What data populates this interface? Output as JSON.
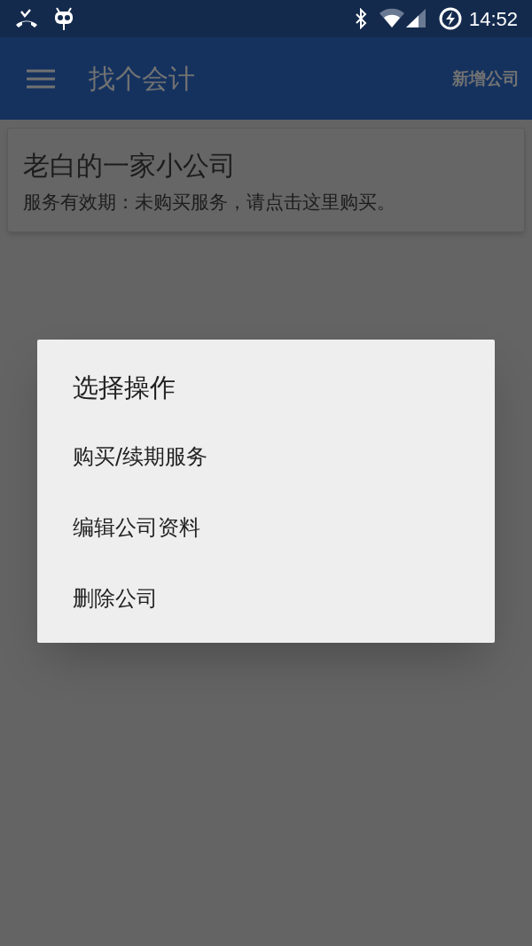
{
  "status_bar": {
    "time": "14:52"
  },
  "app_bar": {
    "title": "找个会计",
    "action": "新增公司"
  },
  "companies": [
    {
      "name": "老白的一家小公司",
      "service": "服务有效期：未购买服务，请点击这里购买。"
    }
  ],
  "dialog": {
    "title": "选择操作",
    "items": [
      "购买/续期服务",
      "编辑公司资料",
      "删除公司"
    ]
  }
}
